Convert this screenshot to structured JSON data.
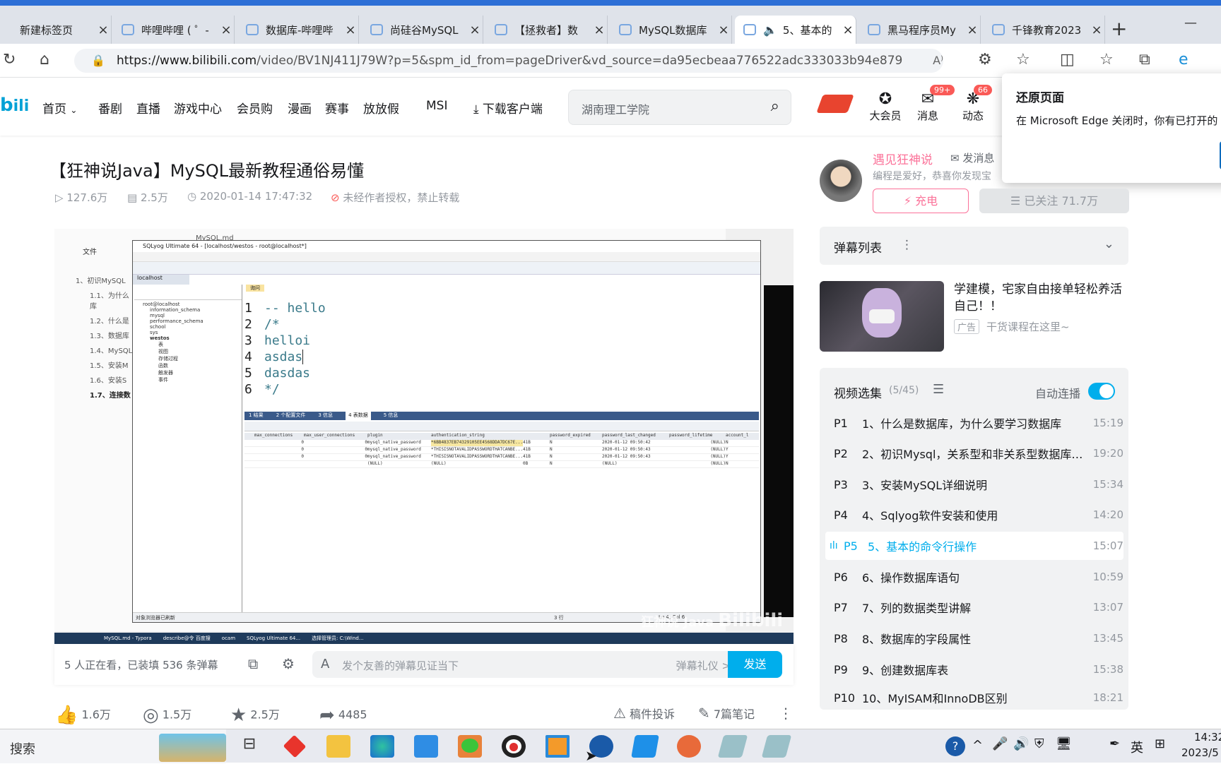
{
  "browser": {
    "tabs": [
      {
        "label": "新建标签页"
      },
      {
        "label": "哔哩哔哩 ( ゜-"
      },
      {
        "label": "数据库-哔哩哔"
      },
      {
        "label": "尚硅谷MySQL"
      },
      {
        "label": "【拯救者】数"
      },
      {
        "label": "MySQL数据库"
      },
      {
        "label": "5、基本的"
      },
      {
        "label": "黑马程序员My"
      },
      {
        "label": "千锋教育2023"
      }
    ],
    "url_host": "https://www.bilibili.com",
    "url_path": "/video/BV1NJ411J79W?p=5&spm_id_from=pageDriver&vd_source=da95ecbeaa776522adc333033b94e879"
  },
  "nav": {
    "items": [
      "首页",
      "番剧",
      "直播",
      "游戏中心",
      "会员购",
      "漫画",
      "赛事",
      "放放假",
      "MSI"
    ],
    "download": "下载客户端",
    "search_placeholder": "湖南理工学院",
    "vip": "大会员",
    "messages": "消息",
    "messages_badge": "99+",
    "dynamics": "动态",
    "dynamics_badge": "66"
  },
  "popup": {
    "title": "还原页面",
    "body": "在 Microsoft Edge 关闭时，你有已打开的"
  },
  "video": {
    "title": "【狂神说Java】MySQL最新教程通俗易懂",
    "views": "127.6万",
    "danmaku_count": "2.5万",
    "date": "2020-01-14 17:47:32",
    "copyright": "未经作者授权，禁止转载",
    "watching": "5 人正在看，已装填 536 条弹幕",
    "danmaku_placeholder": "发个友善的弹幕见证当下",
    "danmaku_etiquette": "弹幕礼仪 >",
    "send": "发送",
    "likes": "1.6万",
    "coins": "1.5万",
    "favorites": "2.5万",
    "shares": "4485",
    "report": "稿件投诉",
    "notes": "7篇笔记"
  },
  "player_content": {
    "sqlyog_title": "SQLyog Ultimate 64 - [localhost/westos - root@localhost*]",
    "typora_file": "MySQL.md",
    "typora_menu": "文件",
    "outline": [
      "1、初识MySQL",
      "1.1、为什么",
      "库",
      "1.2、什么是",
      "1.3、数据库",
      "1.4、MySQL",
      "1.5、安装M",
      "1.6、安装S",
      "1.7、连接数"
    ],
    "conn_tab": "localhost",
    "tree": [
      "root@localhost",
      "information_schema",
      "mysql",
      "performance_schema",
      "school",
      "sys",
      "westos",
      "表",
      "视图",
      "存储过程",
      "函数",
      "触发器",
      "事件"
    ],
    "query_tab": "询问",
    "code_lines": [
      {
        "n": "1",
        "t": "-- hello"
      },
      {
        "n": "2",
        "t": "/*"
      },
      {
        "n": "3",
        "t": "helloi"
      },
      {
        "n": "4",
        "t": "asdas"
      },
      {
        "n": "5",
        "t": "dasdas"
      },
      {
        "n": "6",
        "t": "*/"
      }
    ],
    "result_tabs": [
      "1 结果",
      "2 个配置文件",
      "3 信息",
      "4 表数据",
      "5 信息"
    ],
    "columns": [
      "max_connections",
      "max_user_connections",
      "plugin",
      "authentication_string",
      "password_expired",
      "password_last_changed",
      "password_lifetime",
      "account_l"
    ],
    "rows": [
      [
        "0",
        "0",
        "mysql_native_password",
        "*6BB4837EB74329105EE4568DDA7DC67E...",
        "41B",
        "N",
        "2020-01-12 09:50:42",
        "(NULL)",
        "N"
      ],
      [
        "0",
        "0",
        "mysql_native_password",
        "*THISISNOTAVALIDPASSWORDTHATCANBE...",
        "41B",
        "N",
        "2020-01-12 09:50:43",
        "(NULL)",
        "Y"
      ],
      [
        "0",
        "0",
        "mysql_native_password",
        "*THISISNOTAVALIDPASSWORDTHATCANBE...",
        "41B",
        "N",
        "2020-01-12 09:50:43",
        "(NULL)",
        "Y"
      ],
      [
        "",
        "",
        "(NULL)",
        "(NULL)",
        "0B",
        "N",
        "(NULL)",
        "(NULL)",
        "N"
      ]
    ],
    "status_left": "对象浏览器已刷新",
    "status_rows": "3 行",
    "status_pos": "Ln 4, Col 6",
    "watermark": "狂神说 Java",
    "inner_taskbar": [
      "MySQL.md - Typora",
      "describe@令 百度搜",
      "ocam",
      "SQLyog Ultimate 64...",
      "选择管理员: C:\\Wind..."
    ]
  },
  "uploader": {
    "name": "遇见狂神说",
    "message_btn": "发消息",
    "bio": "编程是爱好，恭喜你发现宝",
    "charge": "充电",
    "followed": "已关注 71.7万"
  },
  "danmaku_list": {
    "title": "弹幕列表"
  },
  "ad": {
    "title": "学建模，宅家自由接单轻松养活自己！！",
    "tag": "广告",
    "sub": "干货课程在这里~"
  },
  "playlist": {
    "title": "视频选集",
    "count": "(5/45)",
    "autoplay": "自动连播",
    "episodes": [
      {
        "p": "P1",
        "t": "1、什么是数据库，为什么要学习数据库",
        "d": "15:19"
      },
      {
        "p": "P2",
        "t": "2、初识Mysql，关系型和非关系型数据库…",
        "d": "19:20"
      },
      {
        "p": "P3",
        "t": "3、安装MySQL详细说明",
        "d": "15:34"
      },
      {
        "p": "P4",
        "t": "4、Sqlyog软件安装和使用",
        "d": "14:20"
      },
      {
        "p": "P5",
        "t": "5、基本的命令行操作",
        "d": "15:07"
      },
      {
        "p": "P6",
        "t": "6、操作数据库语句",
        "d": "10:59"
      },
      {
        "p": "P7",
        "t": "7、列的数据类型讲解",
        "d": "13:07"
      },
      {
        "p": "P8",
        "t": "8、数据库的字段属性",
        "d": "13:45"
      },
      {
        "p": "P9",
        "t": "9、创建数据库表",
        "d": "15:38"
      },
      {
        "p": "P10",
        "t": "10、MyISAM和InnoDB区别",
        "d": "18:21"
      }
    ]
  },
  "taskbar": {
    "search": "搜索",
    "ime": "英",
    "time": "14:32",
    "date": "2023/5"
  }
}
